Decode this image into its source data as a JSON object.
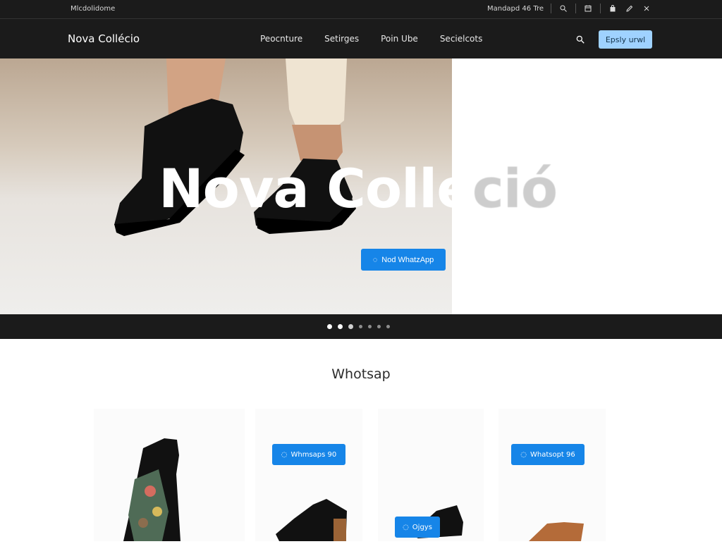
{
  "topbar": {
    "left_text": "Mlcdolidome",
    "right_text": "Mandapd 46 Tre"
  },
  "nav": {
    "brand": "Nova Collécio",
    "menu": [
      "Peocnture",
      "Setirges",
      "Poin Ube",
      "Secielcots"
    ],
    "cta": "Epsly urwl"
  },
  "hero": {
    "title_main": "Nova Colle",
    "title_fade": "ció",
    "button": "Nod WhatzApp"
  },
  "carousel": {
    "dots": [
      {
        "state": "active"
      },
      {
        "state": "active"
      },
      {
        "state": "normal"
      },
      {
        "state": "dim"
      },
      {
        "state": "dim"
      },
      {
        "state": "dim"
      },
      {
        "state": "dim"
      }
    ]
  },
  "section": {
    "title": "Whotsap"
  },
  "cards": [
    {
      "name": "tattoo-boot-card"
    },
    {
      "name": "black-oxford-card",
      "badge": "Whmsaps 90"
    },
    {
      "name": "black-derby-card",
      "badge": "Ojgys"
    },
    {
      "name": "brown-shoe-card",
      "badge": "Whatsopt 96"
    }
  ],
  "colors": {
    "header_bg": "#1b1b1b",
    "accent_blue": "#1685e8",
    "cta_light_blue": "#9fd2ff"
  },
  "icons": {
    "search": "search-icon",
    "calendar": "calendar-icon",
    "bag": "bag-icon",
    "edit": "edit-icon",
    "close": "close-icon",
    "chat": "chat-bubble-icon"
  }
}
